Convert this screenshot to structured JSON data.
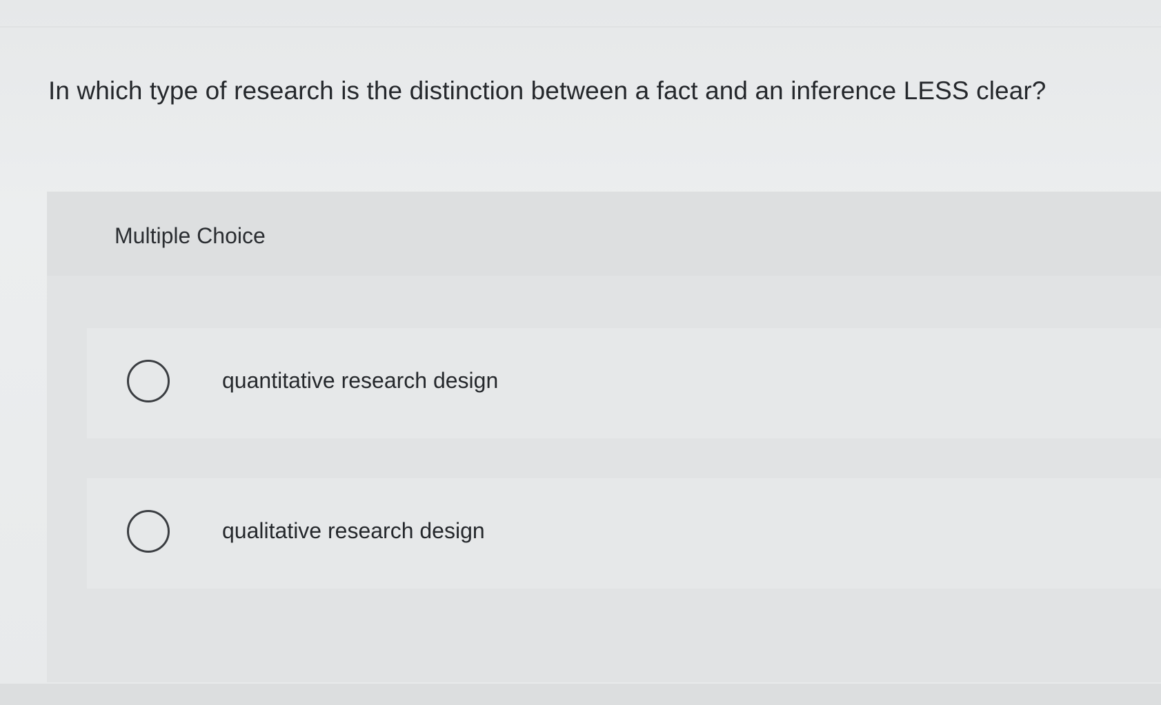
{
  "question": {
    "text": "In which type of research is the distinction between a fact and an inference LESS clear?"
  },
  "multiple_choice": {
    "label": "Multiple Choice",
    "options": [
      {
        "label": "quantitative research design",
        "icon": "radio-unselected"
      },
      {
        "label": "qualitative research design",
        "icon": "radio-unselected"
      }
    ]
  }
}
